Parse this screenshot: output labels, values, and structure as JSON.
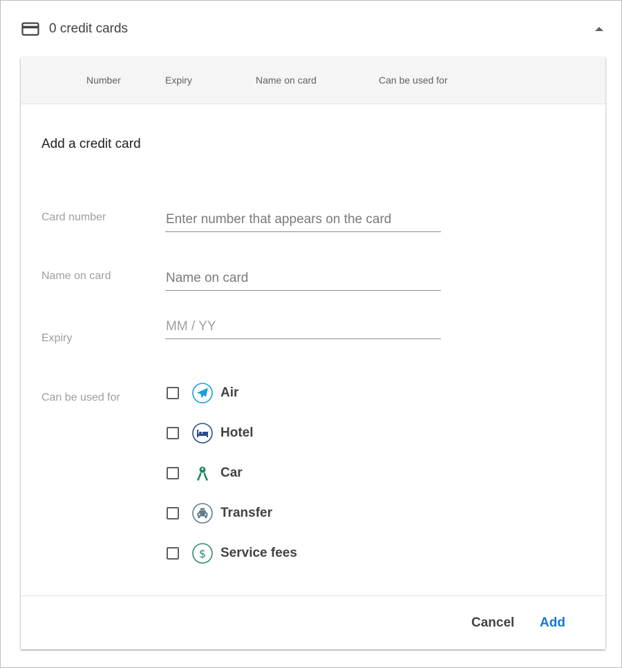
{
  "section": {
    "title": "0 credit cards",
    "icon": "credit-card-icon",
    "collapse_icon": "caret-up-icon"
  },
  "table": {
    "columns": [
      "Number",
      "Expiry",
      "Name on card",
      "Can be used for"
    ]
  },
  "form": {
    "title": "Add a credit card",
    "card_number": {
      "label": "Card number",
      "placeholder": "Enter number that appears on the card",
      "value": ""
    },
    "name_on_card": {
      "label": "Name on card",
      "placeholder": "Name on card",
      "value": ""
    },
    "expiry": {
      "label": "Expiry",
      "placeholder": "MM / YY",
      "value": ""
    },
    "usage": {
      "label": "Can be used for",
      "options": [
        {
          "label": "Air",
          "icon": "airplane-icon",
          "checked": false,
          "color": "#1a9fd9"
        },
        {
          "label": "Hotel",
          "icon": "bed-icon",
          "checked": false,
          "color": "#2b4b8c"
        },
        {
          "label": "Car",
          "icon": "car-keys-icon",
          "checked": false,
          "color": "#1f8a5c"
        },
        {
          "label": "Transfer",
          "icon": "taxi-icon",
          "checked": false,
          "color": "#607d8b"
        },
        {
          "label": "Service fees",
          "icon": "dollar-icon",
          "checked": false,
          "color": "#2e8b66"
        }
      ]
    }
  },
  "footer": {
    "cancel_label": "Cancel",
    "add_label": "Add"
  },
  "colors": {
    "accent": "#1976d2",
    "text": "#424242",
    "muted": "#9e9e9e",
    "header_bg": "#f5f5f5"
  }
}
